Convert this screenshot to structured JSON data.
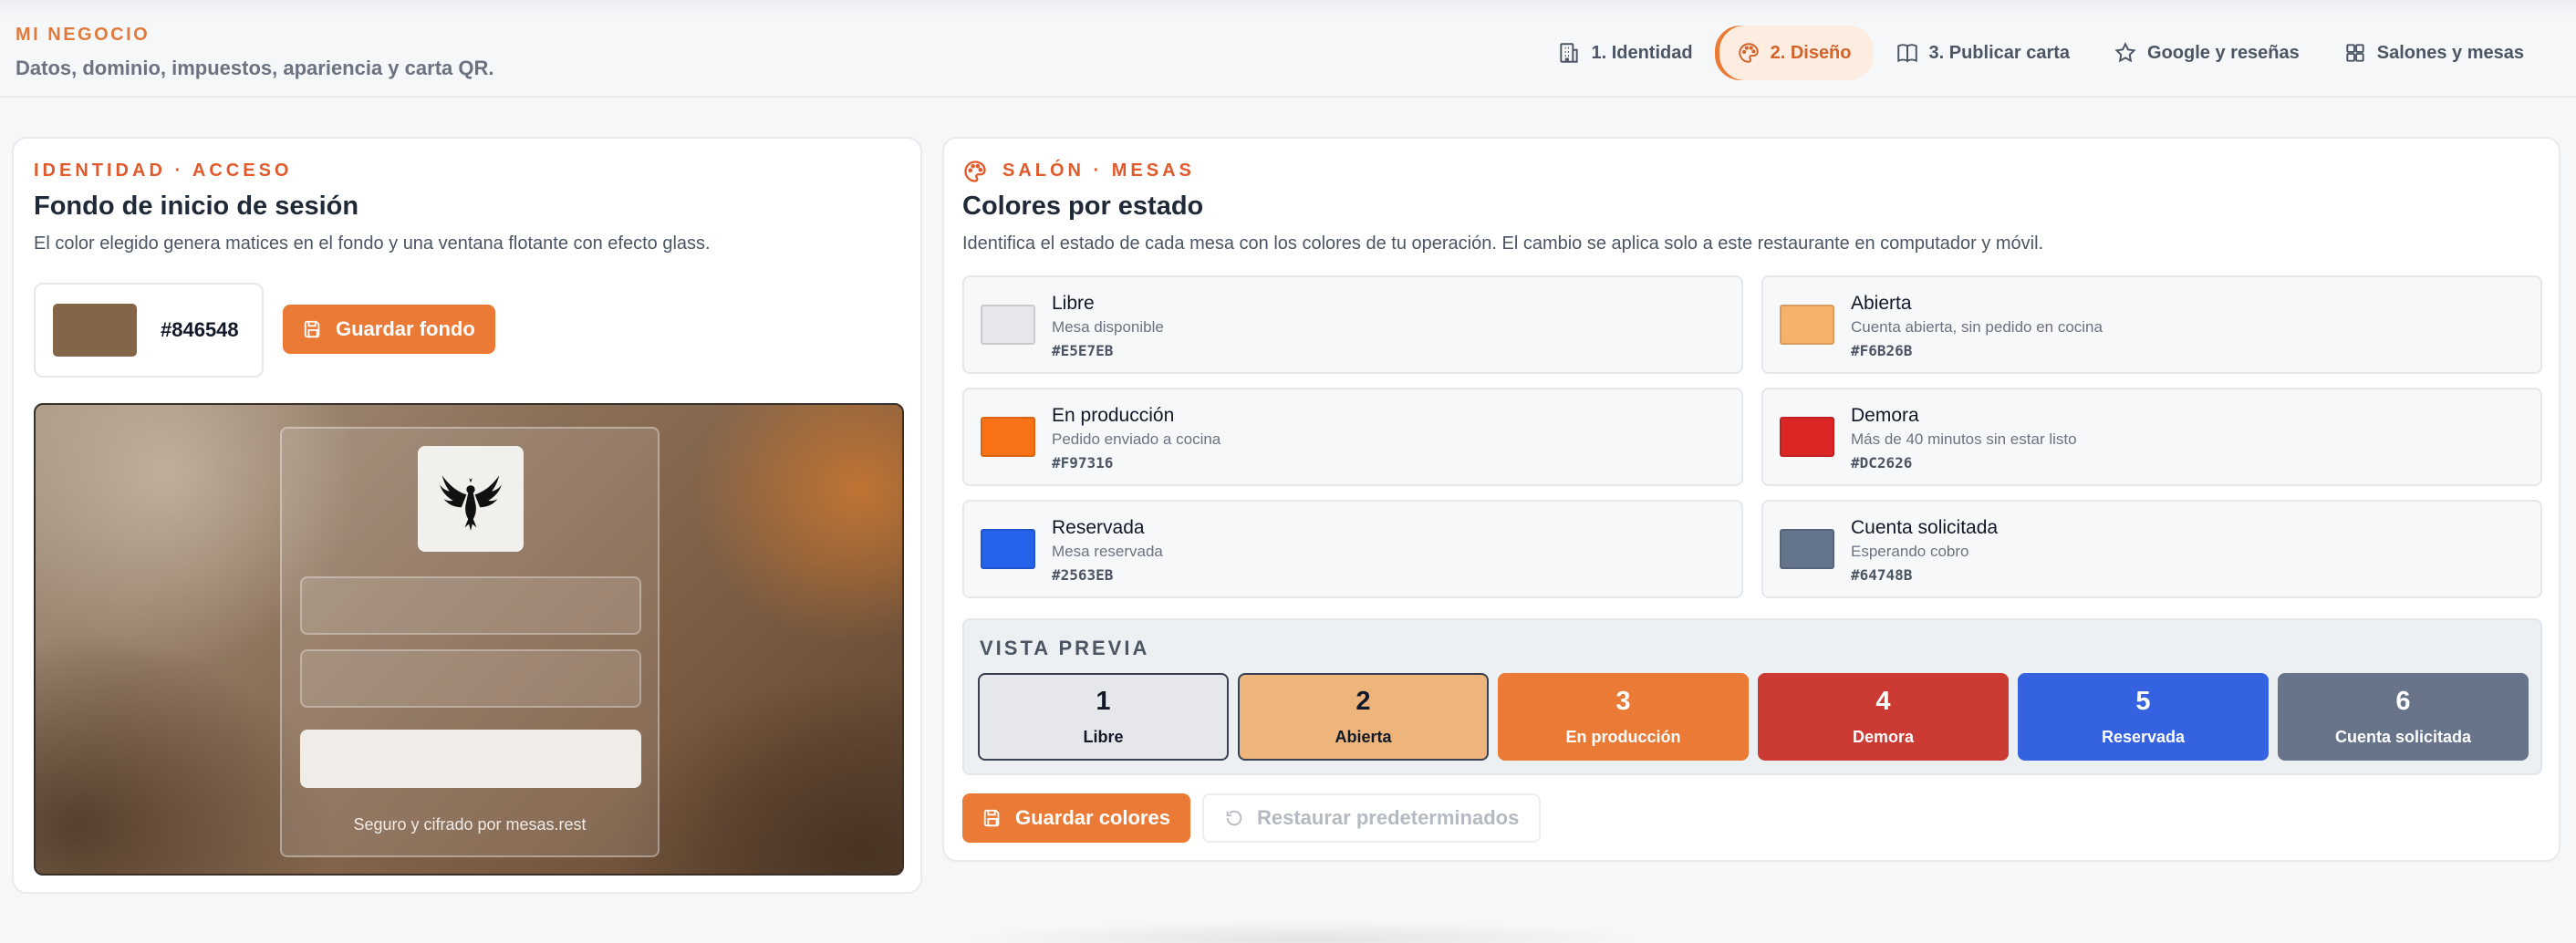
{
  "header": {
    "eyebrow": "MI NEGOCIO",
    "subtitle": "Datos, dominio, impuestos, apariencia y carta QR.",
    "nav": [
      {
        "label": "1. Identidad",
        "icon": "building-icon"
      },
      {
        "label": "2. Diseño",
        "icon": "palette-icon",
        "active": true
      },
      {
        "label": "3. Publicar carta",
        "icon": "book-icon"
      },
      {
        "label": "Google y reseñas",
        "icon": "star-icon"
      },
      {
        "label": "Salones y mesas",
        "icon": "grid-icon"
      }
    ]
  },
  "login_bg": {
    "eyebrow": "IDENTIDAD · ACCESO",
    "title": "Fondo de inicio de sesión",
    "description": "El color elegido genera matices en el fondo y una ventana flotante con efecto glass.",
    "color": "#846548",
    "save_label": "Guardar fondo",
    "preview_footer": "Seguro y cifrado por mesas.rest"
  },
  "states": {
    "eyebrow": "SALÓN · MESAS",
    "title": "Colores por estado",
    "description": "Identifica el estado de cada mesa con los colores de tu operación. El cambio se aplica solo a este restaurante en computador y móvil.",
    "items": [
      {
        "name": "Libre",
        "desc": "Mesa disponible",
        "hex": "#E5E7EB"
      },
      {
        "name": "Abierta",
        "desc": "Cuenta abierta, sin pedido en cocina",
        "hex": "#F6B26B"
      },
      {
        "name": "En producción",
        "desc": "Pedido enviado a cocina",
        "hex": "#F97316"
      },
      {
        "name": "Demora",
        "desc": "Más de 40 minutos sin estar listo",
        "hex": "#DC2626"
      },
      {
        "name": "Reservada",
        "desc": "Mesa reservada",
        "hex": "#2563EB"
      },
      {
        "name": "Cuenta solicitada",
        "desc": "Esperando cobro",
        "hex": "#64748B"
      }
    ],
    "preview_title": "VISTA PREVIA",
    "preview_tables": [
      {
        "num": "1",
        "label": "Libre",
        "bg": "#e5e7eb",
        "fg": "#111827",
        "border": "#374151"
      },
      {
        "num": "2",
        "label": "Abierta",
        "bg": "#edb57b",
        "fg": "#111827",
        "border": "#374151"
      },
      {
        "num": "3",
        "label": "En producción",
        "bg": "#ea7a35",
        "fg": "#ffffff",
        "border": "#ea7a35"
      },
      {
        "num": "4",
        "label": "Demora",
        "bg": "#cb3a33",
        "fg": "#ffffff",
        "border": "#cb3a33"
      },
      {
        "num": "5",
        "label": "Reservada",
        "bg": "#3562e0",
        "fg": "#ffffff",
        "border": "#3562e0"
      },
      {
        "num": "6",
        "label": "Cuenta solicitada",
        "bg": "#67748a",
        "fg": "#ffffff",
        "border": "#67748a"
      }
    ],
    "save_label": "Guardar colores",
    "reset_label": "Restaurar predeterminados"
  }
}
